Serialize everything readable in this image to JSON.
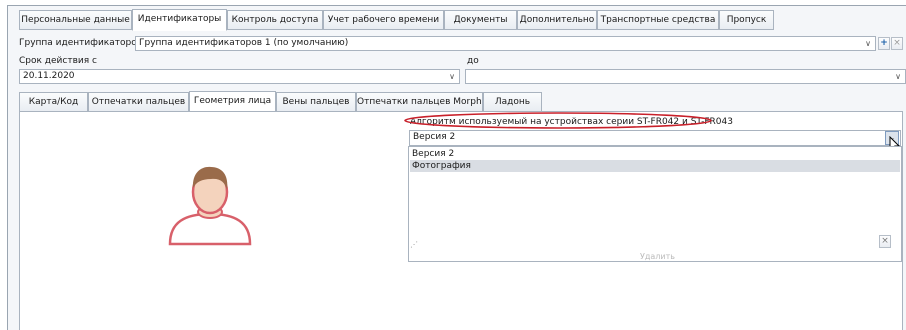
{
  "main_tabs": [
    {
      "label": "Персональные данные"
    },
    {
      "label": "Идентификаторы"
    },
    {
      "label": "Контроль доступа"
    },
    {
      "label": "Учет рабочего времени"
    },
    {
      "label": "Документы"
    },
    {
      "label": "Дополнительно"
    },
    {
      "label": "Транспортные средства"
    },
    {
      "label": "Пропуск"
    }
  ],
  "group": {
    "label": "Группа идентификаторов",
    "value": "Группа идентификаторов 1 (по умолчанию)",
    "add_symbol": "+",
    "clear_symbol": "×"
  },
  "validity": {
    "label_from": "Срок действия с",
    "label_to": "до",
    "from_value": "20.11.2020",
    "to_value": ""
  },
  "sub_tabs": [
    {
      "label": "Карта/Код"
    },
    {
      "label": "Отпечатки пальцев"
    },
    {
      "label": "Геометрия лица"
    },
    {
      "label": "Вены пальцев"
    },
    {
      "label": "Отпечатки пальцев Morpho"
    },
    {
      "label": "Ладонь"
    }
  ],
  "algorithm": {
    "label": "Алгоритм используемый на устройствах серии ST-FR042 и ST-FR043",
    "selected": "Версия 2",
    "options": [
      "Версия 2",
      "Фотография"
    ],
    "bottom_text": "Удалить",
    "close_symbol": "×"
  },
  "colors": {
    "accent": "#c8202a",
    "highlight": "#d9dde3",
    "border": "#a9b3bf",
    "skin": "#f4d3bd",
    "hair": "#9a6b4a"
  },
  "icons": {
    "dropdown": "chevron-down-icon",
    "avatar": "person-avatar-icon"
  }
}
